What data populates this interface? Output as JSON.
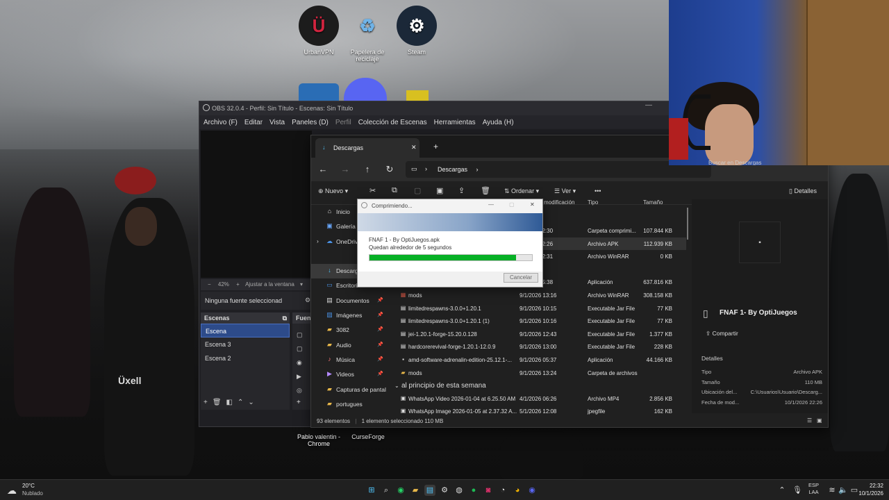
{
  "desktop": {
    "icons": [
      {
        "label": "UrbanVPN",
        "icon": "urbanvpn-icon",
        "glyph": "Ü"
      },
      {
        "label": "Papelera de reciclaje",
        "icon": "recycle-bin-icon",
        "glyph": "♻"
      },
      {
        "label": "Steam",
        "icon": "steam-icon",
        "glyph": "⚙"
      }
    ],
    "bottom_icons": [
      {
        "label": "Pablo valentin - Chrome"
      },
      {
        "label": "CurseForge"
      }
    ]
  },
  "obs": {
    "title": "OBS 32.0.4 - Perfil: Sin Título - Escenas: Sin Título",
    "menu": [
      "Archivo (F)",
      "Editar",
      "Vista",
      "Paneles (D)",
      "Perfil",
      "Colección de Escenas",
      "Herramientas",
      "Ayuda (H)"
    ],
    "zoom_text": "42%",
    "fit_text": "Ajustar a la ventana",
    "no_source": "Ninguna fuente seleccionad",
    "scenes_header": "Escenas",
    "sources_header": "Fuen",
    "scenes": [
      "Escena",
      "Escena 3",
      "Escena 2"
    ]
  },
  "explorer": {
    "tab_title": "Descargas",
    "breadcrumb": "Descargas",
    "search_placeholder": "Buscar en Descargas",
    "toolbar": {
      "new": "Nuevo",
      "sort": "Ordenar",
      "view": "Ver",
      "details": "Detalles"
    },
    "columns": {
      "modified": "modificación",
      "type": "Tipo",
      "size": "Tamaño"
    },
    "nav": [
      {
        "label": "Inicio",
        "icon": "home-icon",
        "glyph": "⌂",
        "pinned": false
      },
      {
        "label": "Galería",
        "icon": "gallery-icon",
        "glyph": "▣",
        "pinned": false
      },
      {
        "label": "OneDrive",
        "icon": "onedrive-icon",
        "glyph": "☁",
        "pinned": false
      },
      {
        "label": "Descargas",
        "icon": "download-icon",
        "glyph": "↓",
        "pinned": true
      },
      {
        "label": "Escritorio",
        "icon": "desktop-icon",
        "glyph": "▭",
        "pinned": true
      },
      {
        "label": "Documentos",
        "icon": "documents-icon",
        "glyph": "▤",
        "pinned": true
      },
      {
        "label": "Imágenes",
        "icon": "images-icon",
        "glyph": "▨",
        "pinned": true
      },
      {
        "label": "3082",
        "icon": "folder-icon",
        "glyph": "▰",
        "pinned": true
      },
      {
        "label": "Audio",
        "icon": "folder-icon",
        "glyph": "▰",
        "pinned": true
      },
      {
        "label": "Música",
        "icon": "music-icon",
        "glyph": "♪",
        "pinned": true
      },
      {
        "label": "Videos",
        "icon": "videos-icon",
        "glyph": "▶",
        "pinned": true
      },
      {
        "label": "Capturas de pantal",
        "icon": "folder-icon",
        "glyph": "▰",
        "pinned": true
      },
      {
        "label": "portugues",
        "icon": "folder-icon",
        "glyph": "▰",
        "pinned": false
      }
    ],
    "files_partial": [
      {
        "date": "22:30",
        "type": "Carpeta comprimi...",
        "size": "107.844 KB"
      },
      {
        "date": "22:26",
        "type": "Archivo APK",
        "size": "112.939 KB"
      },
      {
        "date": "22:31",
        "type": "Archivo WinRAR",
        "size": "0 KB"
      },
      {
        "date": "05:38",
        "type": "Aplicación",
        "size": "637.816 KB"
      }
    ],
    "files": [
      {
        "name": "mods",
        "date": "9/1/2026 13:16",
        "type": "Archivo WinRAR",
        "size": "308.158 KB",
        "icon": "winrar-icon",
        "glyph": "▦"
      },
      {
        "name": "limitedrespawns-3.0.0+1.20.1",
        "date": "9/1/2026 10:15",
        "type": "Executable Jar File",
        "size": "77 KB",
        "icon": "jar-icon",
        "glyph": "▤"
      },
      {
        "name": "limitedrespawns-3.0.0+1.20.1 (1)",
        "date": "9/1/2026 10:16",
        "type": "Executable Jar File",
        "size": "77 KB",
        "icon": "jar-icon",
        "glyph": "▤"
      },
      {
        "name": "jei-1.20.1-forge-15.20.0.128",
        "date": "9/1/2026 12:43",
        "type": "Executable Jar File",
        "size": "1.377 KB",
        "icon": "jar-icon",
        "glyph": "▤"
      },
      {
        "name": "hardcorerevival-forge-1.20.1-12.0.9",
        "date": "9/1/2026 13:00",
        "type": "Executable Jar File",
        "size": "228 KB",
        "icon": "jar-icon",
        "glyph": "▤"
      },
      {
        "name": "amd-software-adrenalin-edition-25.12.1-...",
        "date": "9/1/2026 05:37",
        "type": "Aplicación",
        "size": "44.166 KB",
        "icon": "app-icon",
        "glyph": "▪"
      },
      {
        "name": "mods",
        "date": "9/1/2026 13:24",
        "type": "Carpeta de archivos",
        "size": "",
        "icon": "folder-icon",
        "glyph": "▰"
      }
    ],
    "group_label": "al principio de esta semana",
    "files2": [
      {
        "name": "WhatsApp Video 2026-01-04 at 6.25.50 AM",
        "date": "4/1/2026 06:26",
        "type": "Archivo MP4",
        "size": "2.856 KB",
        "icon": "video-file-icon",
        "glyph": "▣"
      },
      {
        "name": "WhatsApp Image 2026-01-05 at 2.37.32 A...",
        "date": "5/1/2026 12:08",
        "type": "jpegfile",
        "size": "162 KB",
        "icon": "image-file-icon",
        "glyph": "▣"
      }
    ],
    "details_pane": {
      "file_name": "FNAF 1- By OptiJuegos",
      "share": "Compartir",
      "section": "Detalles",
      "props": [
        {
          "k": "Tipo",
          "v": "Archivo APK"
        },
        {
          "k": "Tamaño",
          "v": "110 MB"
        },
        {
          "k": "Ubicación del...",
          "v": "C:\\Usuarios\\Usuario\\Descarg..."
        },
        {
          "k": "Fecha de mod...",
          "v": "10/1/2026 22:26"
        }
      ]
    },
    "status": {
      "count": "93 elementos",
      "selection": "1 elemento seleccionado  110 MB"
    }
  },
  "dialog": {
    "title": "Comprimiendo...",
    "file": "FNAF 1 - By OptiJuegos.apk",
    "remaining": "Quedan alrededor de 5 segundos",
    "progress": 0.9,
    "cancel": "Cancelar"
  },
  "taskbar": {
    "weather_temp": "20°C",
    "weather_desc": "Nublado",
    "lang1": "ESP",
    "lang2": "LAA",
    "time": "22:32",
    "date": "10/1/2026"
  },
  "colors": {
    "accent": "#2d4b8a",
    "progress": "#06b025",
    "selection": "#333333"
  }
}
